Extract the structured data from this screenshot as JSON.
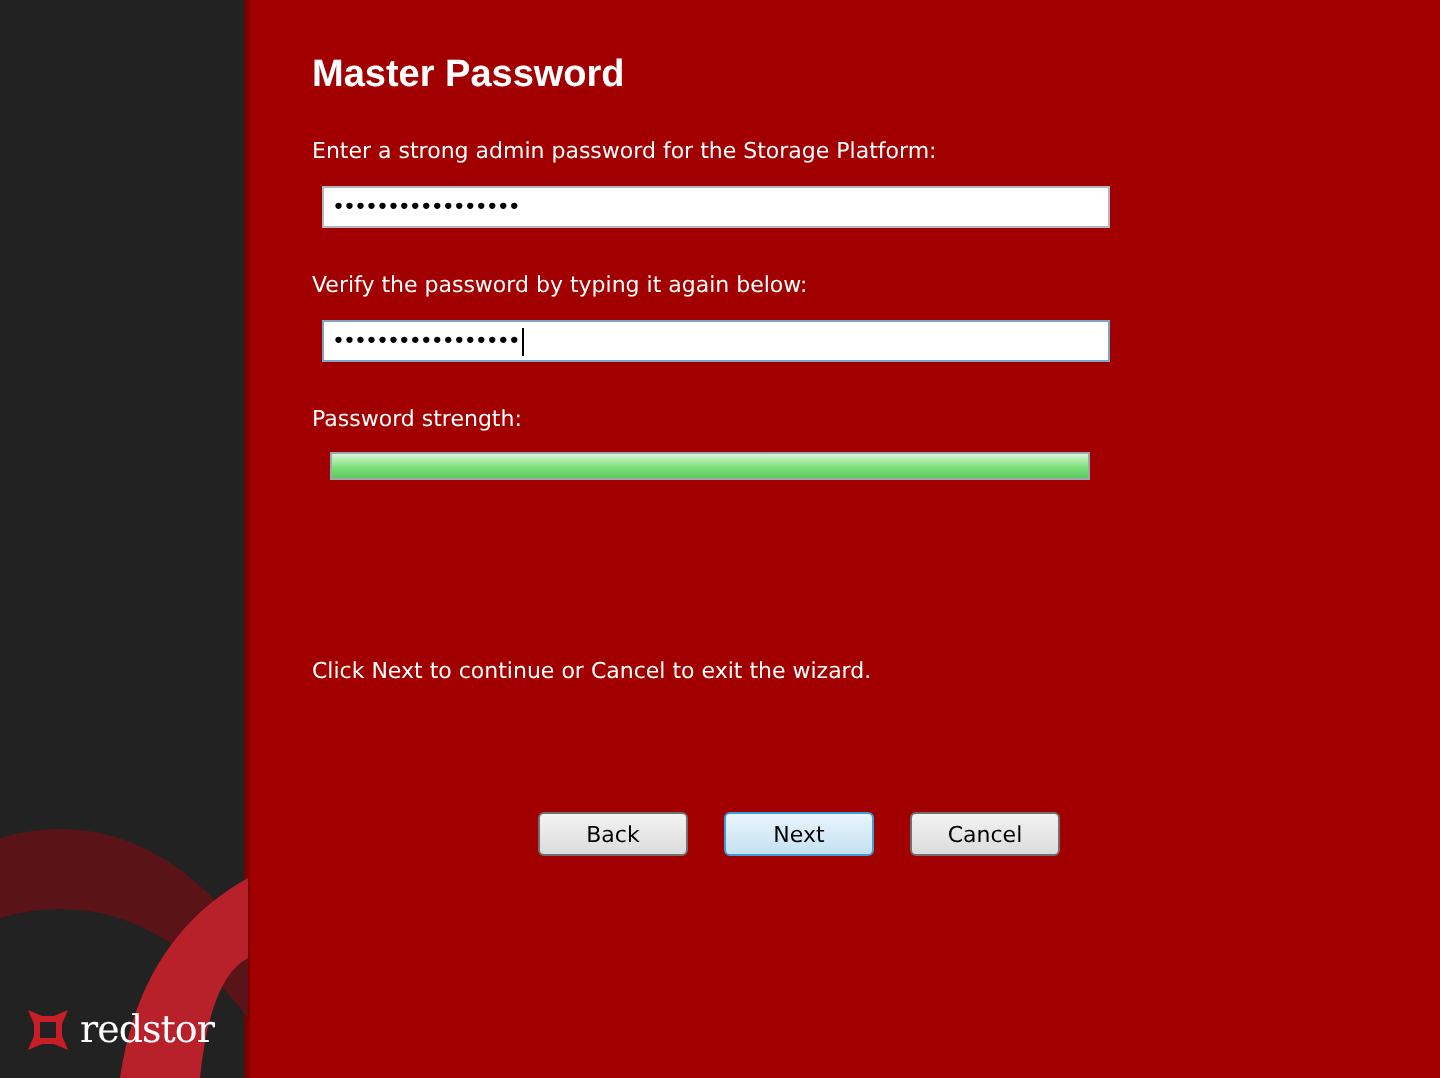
{
  "sidebar": {
    "logo_text": "redstor"
  },
  "title": "Master Password",
  "fields": [
    {
      "label": "Enter a strong admin password for the Storage Platform:",
      "value": "•••••••••••••••••",
      "focused": false
    },
    {
      "label": "Verify the password by typing it again below:",
      "value": "•••••••••••••••••",
      "focused": true
    }
  ],
  "strength": {
    "label": "Password strength:",
    "level": 1
  },
  "hint": "Click Next to continue or Cancel to exit the wizard.",
  "buttons": [
    {
      "label": "Back",
      "focused": false
    },
    {
      "label": "Next",
      "focused": true
    },
    {
      "label": "Cancel",
      "focused": false
    }
  ]
}
